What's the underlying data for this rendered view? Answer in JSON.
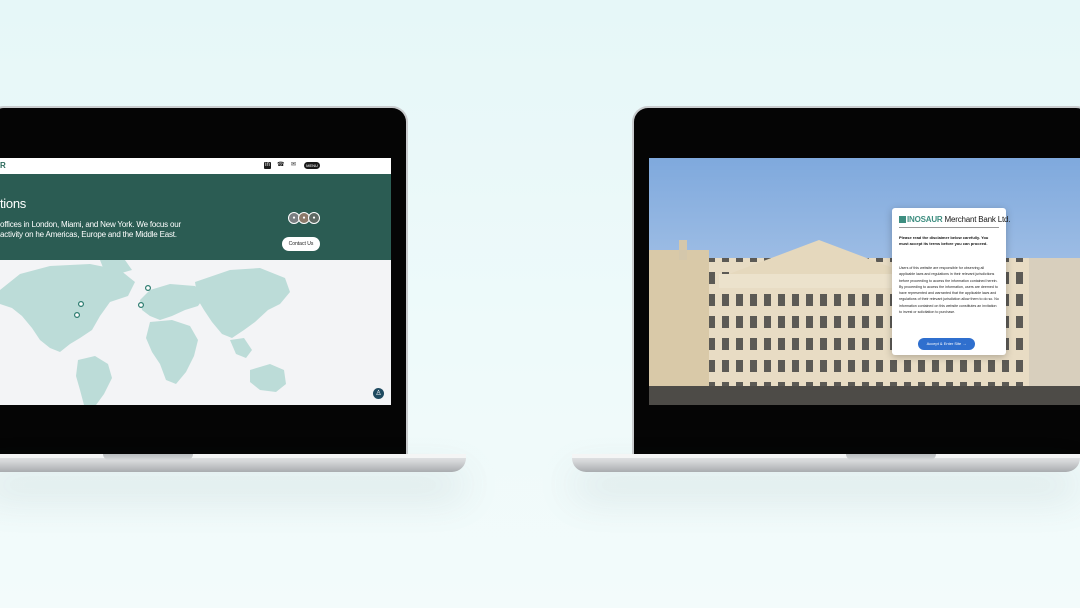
{
  "left_site": {
    "logo": "R",
    "nav_icons": [
      "linkedin-icon",
      "phone-icon",
      "mail-icon"
    ],
    "menu_label": "MENU",
    "heading": "tions",
    "text": "offices in London, Miami, and New York. We focus our activity on he Americas, Europe and the Middle East.",
    "contact_label": "Contact Us",
    "hero_color": "#2b5c53",
    "map_color": "#bcdcd8",
    "accessibility_icon": "accessibility-icon"
  },
  "right_site": {
    "logo_brand": "INOSAUR",
    "logo_rest": " Merchant Bank Ltd.",
    "intro": "Please read the disclaimer below carefully. You must accept its terms before you can proceed.",
    "body": "Users of this website are responsible for observing all applicable laws and regulations in their relevant jurisdictions before proceeding to access the information contained herein. By proceeding to access the information, users are deemed to have represented and warranted that the applicable laws and regulations of their relevant jurisdiction allow them to do so. No information contained on this website constitutes an invitation to invest or solicitation to purchase.",
    "button_label": "Accept & Enter Site →",
    "button_color": "#2f6fce",
    "brand_color": "#3e8e80"
  }
}
